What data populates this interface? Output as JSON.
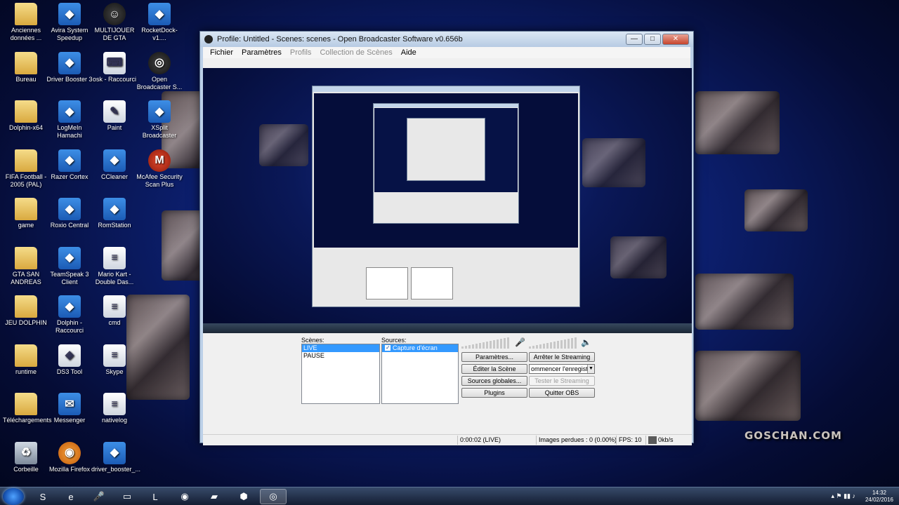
{
  "window": {
    "title": "Profile: Untitled - Scenes: scenes - Open Broadcaster Software v0.656b",
    "menu": [
      {
        "label": "Fichier",
        "enabled": true
      },
      {
        "label": "Paramètres",
        "enabled": true
      },
      {
        "label": "Profils",
        "enabled": false
      },
      {
        "label": "Collection de Scènes",
        "enabled": false
      },
      {
        "label": "Aide",
        "enabled": true
      }
    ],
    "controls": {
      "minimize": "—",
      "maximize": "□",
      "close": "✕"
    }
  },
  "scenes": {
    "label": "Scènes:",
    "items": [
      "LIVE",
      "PAUSE"
    ],
    "selected": "LIVE"
  },
  "sources": {
    "label": "Sources:",
    "items": [
      {
        "name": "Capture d'écran",
        "checked": true
      }
    ]
  },
  "buttons": {
    "settings": "Paramètres...",
    "stop_streaming": "Arrêter le Streaming",
    "edit_scene": "Éditer la Scène",
    "record": "ommencer l'enregistremer",
    "global_sources": "Sources globales...",
    "test_stream": "Tester le Streaming",
    "plugins": "Plugins",
    "quit": "Quitter OBS"
  },
  "status": {
    "time": "0:00:02 (LIVE)",
    "dropped": "Images perdues : 0 (0.00%)",
    "fps": "FPS: 10",
    "bitrate": "0kb/s"
  },
  "desktop_icons": [
    {
      "label": "Anciennes données ...",
      "icon": "folder-icon"
    },
    {
      "label": "Avira System Speedup",
      "icon": "app-icon"
    },
    {
      "label": "MULTIJOUER DE GTA",
      "icon": "game-icon"
    },
    {
      "label": "RocketDock-v1....",
      "icon": "app-icon"
    },
    {
      "label": "Bureau",
      "icon": "folder-icon"
    },
    {
      "label": "Driver Booster 3",
      "icon": "app-icon"
    },
    {
      "label": "osk - Raccourci",
      "icon": "keyboard-icon"
    },
    {
      "label": "Open Broadcaster S...",
      "icon": "obs-icon"
    },
    {
      "label": "Dolphin-x64",
      "icon": "folder-icon"
    },
    {
      "label": "LogMeIn Hamachi",
      "icon": "app-icon"
    },
    {
      "label": "Paint",
      "icon": "paint-icon"
    },
    {
      "label": "XSplit Broadcaster",
      "icon": "app-icon"
    },
    {
      "label": "FIFA Football - 2005 (PAL)",
      "icon": "folder-icon"
    },
    {
      "label": "Razer Cortex",
      "icon": "app-icon"
    },
    {
      "label": "CCleaner",
      "icon": "app-icon"
    },
    {
      "label": "McAfee Security Scan Plus",
      "icon": "shield-icon"
    },
    {
      "label": "game",
      "icon": "folder-icon"
    },
    {
      "label": "Roxio Central",
      "icon": "app-icon"
    },
    {
      "label": "RomStation",
      "icon": "app-icon"
    },
    {
      "label": "GTA SAN ANDREAS",
      "icon": "folder-icon"
    },
    {
      "label": "TeamSpeak 3 Client",
      "icon": "app-icon"
    },
    {
      "label": "Mario Kart - Double Das...",
      "icon": "file-icon"
    },
    {
      "label": "JEU DOLPHIN",
      "icon": "folder-icon"
    },
    {
      "label": "Dolphin - Raccourci",
      "icon": "app-icon"
    },
    {
      "label": "cmd",
      "icon": "file-icon"
    },
    {
      "label": "runtime",
      "icon": "folder-icon"
    },
    {
      "label": "DS3 Tool",
      "icon": "gamepad-icon"
    },
    {
      "label": "Skype",
      "icon": "file-icon"
    },
    {
      "label": "Téléchargements",
      "icon": "folder-icon"
    },
    {
      "label": "Messenger",
      "icon": "messenger-icon"
    },
    {
      "label": "nativelog",
      "icon": "file-icon"
    },
    {
      "label": "Corbeille",
      "icon": "recycle-bin-icon"
    },
    {
      "label": "Mozilla Firefox",
      "icon": "firefox-icon"
    },
    {
      "label": "driver_booster_...",
      "icon": "app-icon"
    }
  ],
  "taskbar": {
    "items": [
      "skype-icon",
      "ie-icon",
      "mic-icon",
      "window-icon",
      "league-icon",
      "firefox-icon",
      "folder-icon",
      "game-icon",
      "obs-icon"
    ],
    "clock_time": "14:32",
    "clock_date": "24/02/2016"
  },
  "wallpaper_text": "GOSCHAN.COM"
}
